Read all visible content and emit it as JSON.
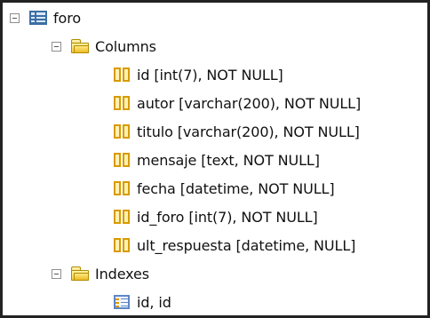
{
  "tree": {
    "root": {
      "label": "foro",
      "icon": "table-icon"
    },
    "columns": {
      "label": "Columns",
      "icon": "folder-icon",
      "items": [
        {
          "label": "id [int(7), NOT NULL]",
          "icon": "column-icon"
        },
        {
          "label": "autor [varchar(200), NOT NULL]",
          "icon": "column-icon"
        },
        {
          "label": "titulo [varchar(200), NOT NULL]",
          "icon": "column-icon"
        },
        {
          "label": "mensaje [text, NOT NULL]",
          "icon": "column-icon"
        },
        {
          "label": "fecha [datetime, NOT NULL]",
          "icon": "column-icon"
        },
        {
          "label": "id_foro [int(7), NOT NULL]",
          "icon": "column-icon"
        },
        {
          "label": "ult_respuesta [datetime, NULL]",
          "icon": "column-icon"
        }
      ]
    },
    "indexes": {
      "label": "Indexes",
      "icon": "folder-icon",
      "items": [
        {
          "label": "id, id",
          "icon": "index-icon"
        }
      ]
    }
  },
  "colors": {
    "border": "#222222",
    "text": "#111111",
    "table_blue": "#3b6ea5",
    "folder_gold": "#f2c83f",
    "column_orange": "#d89a00"
  }
}
